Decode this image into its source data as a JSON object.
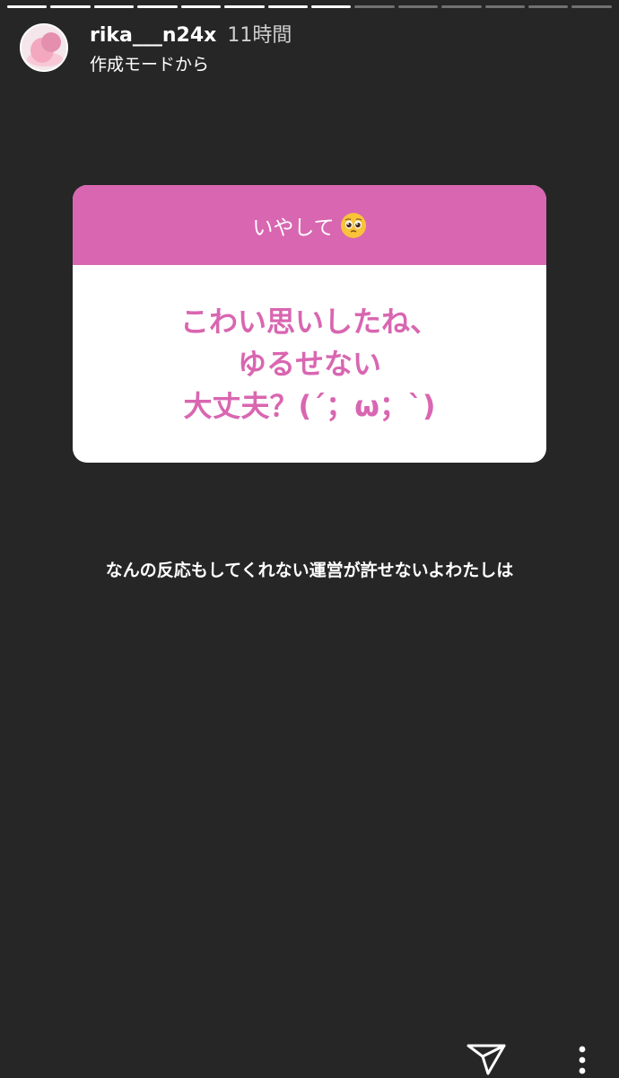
{
  "progress": {
    "segment_count": 14,
    "segments": [
      1,
      1,
      1,
      1,
      1,
      1,
      1,
      1,
      0,
      0,
      0,
      0,
      0,
      0
    ]
  },
  "header": {
    "avatar_icon": "profile-avatar",
    "username": "rika___n24x",
    "time": "11時間",
    "subtitle": "作成モードから"
  },
  "question_card": {
    "prompt": "いやして",
    "prompt_emoji": "pleading-face-emoji",
    "answer_lines": [
      "こわい思いしたね、",
      "ゆるせない",
      "大丈夫？(´；ω；`)"
    ],
    "accent_color": "#d966b1"
  },
  "caption": "なんの反応もしてくれない運営が許せないよわたしは",
  "footer": {
    "send_icon": "paper-plane-icon",
    "more_icon": "more-vertical-icon"
  }
}
